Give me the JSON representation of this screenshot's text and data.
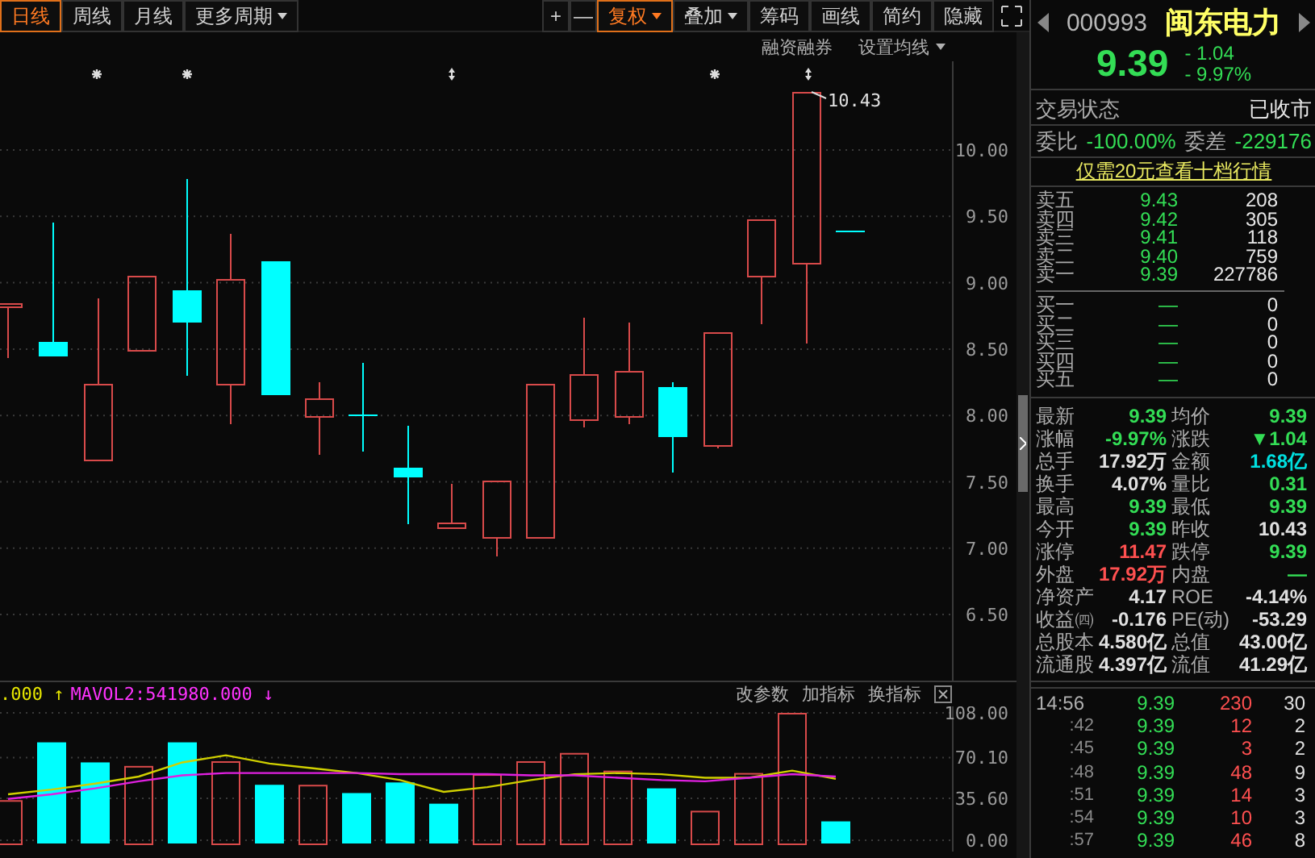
{
  "toolbar": {
    "period_tabs": [
      {
        "label": "日线",
        "selected": true,
        "dropdown": false
      },
      {
        "label": "周线",
        "selected": false,
        "dropdown": false
      },
      {
        "label": "月线",
        "selected": false,
        "dropdown": false
      },
      {
        "label": "更多周期",
        "selected": false,
        "dropdown": true
      }
    ],
    "tools": [
      {
        "label": "+",
        "selected": false,
        "dropdown": false
      },
      {
        "label": "—",
        "selected": false,
        "dropdown": false
      },
      {
        "label": "复权",
        "selected": true,
        "dropdown": true
      },
      {
        "label": "叠加",
        "selected": false,
        "dropdown": true
      },
      {
        "label": "筹码",
        "selected": false,
        "dropdown": false
      },
      {
        "label": "画线",
        "selected": false,
        "dropdown": false
      },
      {
        "label": "简约",
        "selected": false,
        "dropdown": false
      },
      {
        "label": "隐藏",
        "selected": false,
        "dropdown": false
      }
    ]
  },
  "chart_options": [
    {
      "label": "融资融券",
      "dropdown": false
    },
    {
      "label": "设置均线",
      "dropdown": true
    }
  ],
  "price_chart": {
    "axis_labels": [
      "10.00",
      "9.50",
      "9.00",
      "8.50",
      "8.00",
      "7.50",
      "7.00",
      "6.50"
    ],
    "high_label": "10.43"
  },
  "volume_chart": {
    "indicators": [
      {
        "text": ".000",
        "arrow": "↑",
        "color": "#e6e600"
      },
      {
        "text": "MAVOL2:541980.000",
        "arrow": "↓",
        "color": "#ff33ff"
      }
    ],
    "actions": [
      "改参数",
      "加指标",
      "换指标"
    ],
    "chart_data": {
      "type": "bar",
      "series": [
        {
          "color": "#d84a4a",
          "values": [
            34,
            null,
            null,
            63,
            null,
            67,
            null,
            47,
            null,
            null,
            null,
            56,
            67,
            74,
            59,
            null,
            25,
            57,
            108,
            null
          ]
        },
        {
          "color": "#00ffff",
          "values": [
            null,
            83,
            66,
            null,
            83,
            null,
            47,
            null,
            40,
            49,
            31,
            null,
            null,
            null,
            null,
            44,
            null,
            null,
            null,
            16
          ]
        },
        {
          "type": "line",
          "color": "#d0d000",
          "values": [
            39,
            43,
            48,
            54,
            66,
            72,
            65,
            61,
            57,
            51,
            41,
            45,
            51,
            56,
            57,
            56,
            53,
            53,
            59,
            52
          ]
        },
        {
          "type": "line",
          "color": "#e020e0",
          "values": [
            35,
            39,
            44,
            50,
            55,
            57,
            57,
            57,
            57,
            56,
            56,
            56,
            55,
            55,
            53,
            51,
            50,
            53,
            56,
            54
          ]
        }
      ],
      "ylim": [
        0,
        108
      ],
      "yticks": [
        {
          "value": 108,
          "label": "108.00"
        },
        {
          "value": 70.1,
          "label": "70.10"
        },
        {
          "value": 35.6,
          "label": "35.60"
        },
        {
          "value": 0,
          "label": "0.00"
        }
      ]
    }
  },
  "stock": {
    "code": "000993",
    "name": "闽东电力",
    "price": "9.39",
    "change": "- 1.04",
    "change_pct": "- 9.97%",
    "color": "#33dd55"
  },
  "status": {
    "label": "交易状态",
    "value": "已收市"
  },
  "commission": [
    {
      "label": "委比",
      "value": "-100.00%"
    },
    {
      "label": "委差",
      "value": "-229176"
    }
  ],
  "promo_link": "仅需20元查看十档行情",
  "asks": [
    {
      "label": "卖五",
      "price": "9.43",
      "volume": "208"
    },
    {
      "label": "卖四",
      "price": "9.42",
      "volume": "305"
    },
    {
      "label": "卖三",
      "price": "9.41",
      "volume": "118"
    },
    {
      "label": "卖二",
      "price": "9.40",
      "volume": "759"
    },
    {
      "label": "卖一",
      "price": "9.39",
      "volume": "227786"
    }
  ],
  "bids": [
    {
      "label": "买一",
      "price": "—",
      "volume": "0"
    },
    {
      "label": "买二",
      "price": "—",
      "volume": "0"
    },
    {
      "label": "买三",
      "price": "—",
      "volume": "0"
    },
    {
      "label": "买四",
      "price": "—",
      "volume": "0"
    },
    {
      "label": "买五",
      "price": "—",
      "volume": "0"
    }
  ],
  "stats": [
    {
      "label": "最新",
      "value": "9.39",
      "color": "#33dd55"
    },
    {
      "label": "均价",
      "value": "9.39",
      "color": "#33dd55"
    },
    {
      "label": "涨幅",
      "value": "-9.97%",
      "color": "#33dd55"
    },
    {
      "label": "涨跌",
      "value": "▼1.04",
      "color": "#33dd55"
    },
    {
      "label": "总手",
      "value": "17.92万",
      "color": "#e0e0e0"
    },
    {
      "label": "金额",
      "value": "1.68亿",
      "color": "#00e0e0"
    },
    {
      "label": "换手",
      "value": "4.07%",
      "color": "#e0e0e0"
    },
    {
      "label": "量比",
      "value": "0.31",
      "color": "#33dd55"
    },
    {
      "label": "最高",
      "value": "9.39",
      "color": "#33dd55"
    },
    {
      "label": "最低",
      "value": "9.39",
      "color": "#33dd55"
    },
    {
      "label": "今开",
      "value": "9.39",
      "color": "#33dd55"
    },
    {
      "label": "昨收",
      "value": "10.43",
      "color": "#e0e0e0"
    },
    {
      "label": "涨停",
      "value": "11.47",
      "color": "#ff5050"
    },
    {
      "label": "跌停",
      "value": "9.39",
      "color": "#33dd55"
    },
    {
      "label": "外盘",
      "value": "17.92万",
      "color": "#ff5050"
    },
    {
      "label": "内盘",
      "value": "—",
      "color": "#33dd55"
    },
    {
      "label": "净资产",
      "value": "4.17",
      "color": "#e0e0e0"
    },
    {
      "label": "ROE",
      "value": "-4.14%",
      "color": "#e0e0e0"
    },
    {
      "label": "收益㈣",
      "value": "-0.176",
      "color": "#e0e0e0"
    },
    {
      "label": "PE(动)",
      "value": "-53.29",
      "color": "#e0e0e0"
    },
    {
      "label": "总股本",
      "value": "4.580亿",
      "color": "#e0e0e0"
    },
    {
      "label": "总值",
      "value": "43.00亿",
      "color": "#e0e0e0"
    },
    {
      "label": "流通股",
      "value": "4.397亿",
      "color": "#e0e0e0"
    },
    {
      "label": "流值",
      "value": "41.29亿",
      "color": "#e0e0e0"
    }
  ],
  "ticks": [
    {
      "time": "14:56",
      "price": "9.39",
      "volume": "230",
      "count": "30"
    },
    {
      "time": ":42",
      "price": "9.39",
      "volume": "12",
      "count": "2"
    },
    {
      "time": ":45",
      "price": "9.39",
      "volume": "3",
      "count": "2"
    },
    {
      "time": ":48",
      "price": "9.39",
      "volume": "48",
      "count": "9"
    },
    {
      "time": ":51",
      "price": "9.39",
      "volume": "14",
      "count": "3"
    },
    {
      "time": ":54",
      "price": "9.39",
      "volume": "10",
      "count": "3"
    },
    {
      "time": ":57",
      "price": "9.39",
      "volume": "46",
      "count": "8"
    }
  ]
}
